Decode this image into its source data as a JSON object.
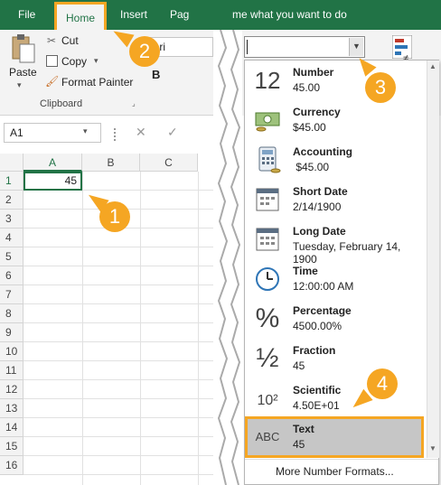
{
  "tabs": {
    "file": "File",
    "home": "Home",
    "insert": "Insert",
    "page": "Pag",
    "tell": "me what you want to do"
  },
  "clipboard": {
    "paste": "Paste",
    "cut": "Cut",
    "copy": "Copy",
    "format_painter": "Format Painter",
    "group_label": "Clipboard",
    "font_fragment": "ibri",
    "bold_glyph": "B"
  },
  "namebox": {
    "value": "A1"
  },
  "grid": {
    "columns": [
      "A",
      "B",
      "C"
    ],
    "rows": [
      "1",
      "2",
      "3",
      "4",
      "5",
      "6",
      "7",
      "8",
      "9",
      "10",
      "11",
      "12",
      "13",
      "14",
      "15",
      "16"
    ],
    "a1_value": "45"
  },
  "format_dropdown": {
    "current_value": "",
    "items": [
      {
        "name": "Number",
        "sample": "45.00",
        "icon": "number-icon",
        "glyph": "12"
      },
      {
        "name": "Currency",
        "sample": "$45.00",
        "icon": "currency-icon",
        "glyph": ""
      },
      {
        "name": "Accounting",
        "sample": " $45.00",
        "icon": "accounting-icon",
        "glyph": ""
      },
      {
        "name": "Short Date",
        "sample": "2/14/1900",
        "icon": "short-date-icon",
        "glyph": ""
      },
      {
        "name": "Long Date",
        "sample": "Tuesday, February 14, 1900",
        "icon": "long-date-icon",
        "glyph": ""
      },
      {
        "name": "Time",
        "sample": "12:00:00 AM",
        "icon": "clock-icon",
        "glyph": ""
      },
      {
        "name": "Percentage",
        "sample": "4500.00%",
        "icon": "percent-icon",
        "glyph": "%"
      },
      {
        "name": "Fraction",
        "sample": "45",
        "icon": "fraction-icon",
        "glyph": "½"
      },
      {
        "name": "Scientific",
        "sample": "4.50E+01",
        "icon": "scientific-icon",
        "glyph": "10²"
      },
      {
        "name": "Text",
        "sample": "45",
        "icon": "text-abc-icon",
        "glyph": "ABC"
      }
    ],
    "more": "More Number Formats..."
  },
  "callouts": [
    "1",
    "2",
    "3",
    "4"
  ],
  "colors": {
    "excel_green": "#217346",
    "callout": "#f5a623"
  }
}
